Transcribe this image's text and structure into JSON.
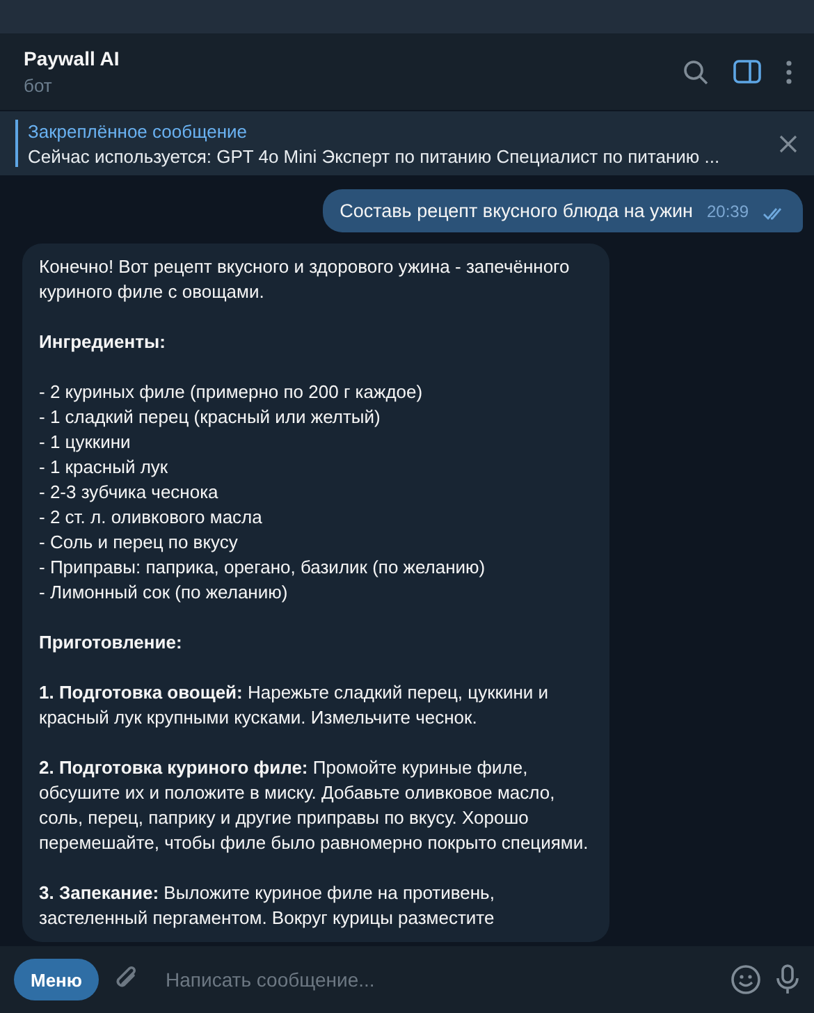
{
  "header": {
    "title": "Paywall AI",
    "subtitle": "бот"
  },
  "pinned": {
    "title": "Закреплённое сообщение",
    "text": "Сейчас используется: GPT 4o Mini Эксперт по питанию Специалист по питанию ..."
  },
  "messages": [
    {
      "kind": "outgoing",
      "text": "Составь рецепт вкусного блюда на ужин",
      "time": "20:39",
      "read": true
    },
    {
      "kind": "incoming",
      "blocks": [
        {
          "kind": "text",
          "text": "Конечно! Вот рецепт вкусного и здорового ужина - запечённого куриного филе с овощами."
        },
        {
          "kind": "heading",
          "text": "Ингредиенты:"
        },
        {
          "kind": "list",
          "items": [
            "- 2 куриных филе (примерно по 200 г каждое)",
            "- 1 сладкий перец (красный или желтый)",
            "- 1 цуккини",
            "- 1 красный лук",
            "- 2-3 зубчика чеснока",
            "- 2 ст. л. оливкового масла",
            "- Соль и перец по вкусу",
            "- Приправы: паприка, орегано, базилик (по желанию)",
            "- Лимонный сок (по желанию)"
          ]
        },
        {
          "kind": "heading",
          "text": "Приготовление:"
        },
        {
          "kind": "text",
          "text": "**1. Подготовка овощей:** Нарежьте сладкий перец, цуккини и красный лук крупными кусками. Измельчите чеснок."
        },
        {
          "kind": "text",
          "text": "**2. Подготовка куриного филе:** Промойте куриные филе, обсушите их и положите в миску. Добавьте оливковое масло, соль, перец, паприку и другие приправы по вкусу. Хорошо перемешайте, чтобы филе было равномерно покрыто специями."
        },
        {
          "kind": "text",
          "text": "**3. Запекание:** Выложите куриное филе на противень, застеленный пергаментом. Вокруг курицы разместите"
        }
      ]
    }
  ],
  "composer": {
    "menu_label": "Меню",
    "placeholder": "Написать сообщение..."
  }
}
